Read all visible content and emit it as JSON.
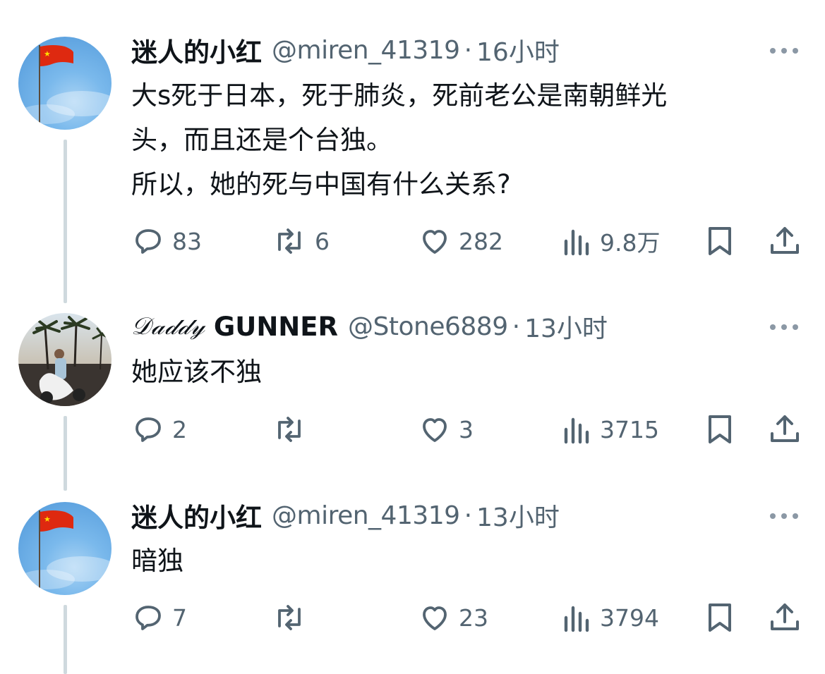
{
  "tweets": [
    {
      "display_name": "迷人的小红",
      "script_prefix": "",
      "handle": "@miren_41319",
      "separator": "·",
      "time": "16小时",
      "lines": [
        "大s死于日本，死于肺炎，死前老公是南朝鲜光",
        "头，而且还是个台独。",
        "所以，她的死与中国有什么关系?"
      ],
      "replies": "83",
      "reposts": "6",
      "likes": "282",
      "views": "9.8万",
      "avatar": "chinese-flag-sky"
    },
    {
      "display_name": "GUNNER",
      "script_prefix": "𝒟𝒶𝒹𝒹𝓎",
      "handle": "@Stone6889",
      "separator": "·",
      "time": "13小时",
      "lines": [
        "她应该不独"
      ],
      "replies": "2",
      "reposts": "",
      "likes": "3",
      "views": "3715",
      "avatar": "palm-trees-scooter-photo"
    },
    {
      "display_name": "迷人的小红",
      "script_prefix": "",
      "handle": "@miren_41319",
      "separator": "·",
      "time": "13小时",
      "lines": [
        "暗独"
      ],
      "replies": "7",
      "reposts": "",
      "likes": "23",
      "views": "3794",
      "avatar": "chinese-flag-sky"
    }
  ],
  "colors": {
    "text": "#0f1419",
    "secondary": "#536471",
    "thread_line": "#cfd9de",
    "flag_red": "#de2910",
    "flag_star": "#ffde00"
  }
}
